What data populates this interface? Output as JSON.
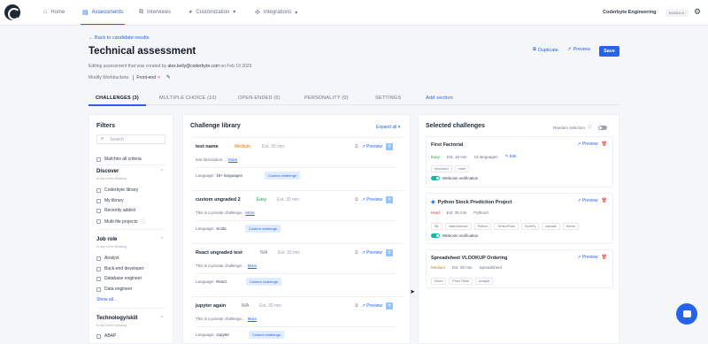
{
  "nav": {
    "items": [
      {
        "label": "Home",
        "icon": "home-icon"
      },
      {
        "label": "Assessments",
        "icon": "assessment-icon"
      },
      {
        "label": "Interviews",
        "icon": "interviews-icon"
      },
      {
        "label": "Customization",
        "icon": "customization-icon"
      },
      {
        "label": "Integrations",
        "icon": "integrations-icon"
      }
    ],
    "company": "Coderbyte Engineering",
    "badge": "BUNDLE"
  },
  "header": {
    "back": "← Back to candidate results",
    "title": "Technical assessment",
    "edit_prefix": "Editing assessment that was created by ",
    "edit_email": "alex.kelly@coderbyte.com",
    "edit_suffix": " on Feb 19 2025",
    "modify_label": "Modify Workbuckets:",
    "modify_tag": "Front-end",
    "duplicate": "Duplicate",
    "preview": "Preview",
    "save": "Save"
  },
  "tabs": [
    "CHALLENGES (3)",
    "MULTIPLE CHOICE (10)",
    "OPEN-ENDED (5)",
    "PERSONALITY (0)",
    "SETTINGS",
    "Add section"
  ],
  "filters": {
    "title": "Filters",
    "search_placeholder": "Search",
    "matches_all": "Matches all criteria",
    "discover": {
      "title": "Discover",
      "sub": "In any of the following",
      "items": [
        "Coderbyte library",
        "My library",
        "Recently added",
        "Multi-file projects"
      ]
    },
    "job_role": {
      "title": "Job role",
      "sub": "In any of the following",
      "items": [
        "Analyst",
        "Back-end developer",
        "Database engineer",
        "Data engineer"
      ],
      "show_all": "Show all..."
    },
    "tech": {
      "title": "Technology/skill",
      "sub": "In any of the following",
      "items": [
        "ABAP"
      ]
    }
  },
  "library": {
    "title": "Challenge library",
    "expand": "Expand all",
    "preview_label": "Preview",
    "language_label": "Language:",
    "custom_label": "Custom challenge",
    "more_label": "More",
    "cards": [
      {
        "name": "test name",
        "difficulty": "Medium",
        "diff_color": "#d97706",
        "est": "Est. 30 min",
        "desc": "test description...",
        "language": "18+ languages"
      },
      {
        "name": "custom ungraded 2",
        "difficulty": "Easy",
        "diff_color": "#16a34a",
        "est": "Est. 30 min",
        "desc": "This is a private challenge.",
        "language": "Scala"
      },
      {
        "name": "React ungraded test",
        "difficulty": "N/A",
        "diff_color": "#6b7280",
        "est": "Est. 30 min",
        "desc": "This is a private challenge...",
        "language": "React"
      },
      {
        "name": "jupyter again",
        "difficulty": "N/A",
        "diff_color": "#6b7280",
        "est": "Est. 30 min",
        "desc": "This is a private challenge...",
        "language": "Jupyter"
      }
    ]
  },
  "selected": {
    "title": "Selected challenges",
    "random": "Random selection",
    "preview_label": "Preview",
    "webcam_label": "Webcam verification",
    "cards": [
      {
        "name": "First Factorial",
        "difficulty": "Easy",
        "diff_color": "#16a34a",
        "est": "Est. 18 min",
        "lang": "19 languages",
        "edit": "Edit",
        "tags": [
          "recursion",
          "math"
        ]
      },
      {
        "name": "Python Stock Prediction Project",
        "difficulty": "Hard",
        "diff_color": "#dc2626",
        "est": "Est. 35 min",
        "lang": "Python3",
        "tags": [
          "ML",
          "data science",
          "Python",
          "TensorFlow",
          "NumPy",
          "pandas",
          "Keras"
        ]
      },
      {
        "name": "Spreadsheet VLOOKUP Ordering",
        "difficulty": "Medium",
        "diff_color": "#d97706",
        "est": "Est. 30 min",
        "lang": "Spreadsheet",
        "tags": [
          "Excel",
          "Pivot Table",
          "Analyst"
        ]
      }
    ]
  }
}
